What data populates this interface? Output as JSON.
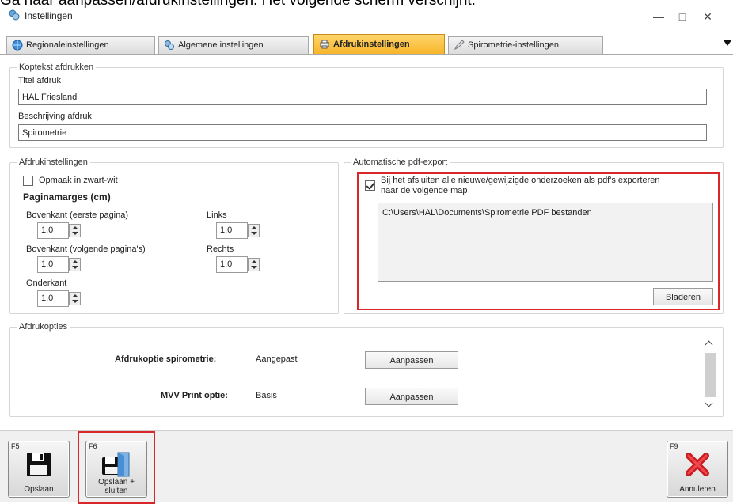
{
  "instruction": "Ga naar aanpassen/afdrukinstellingen. Het volgende scherm verschijnt:",
  "window": {
    "title": "Instellingen",
    "minimize": "—",
    "maximize": "□",
    "close": "✕"
  },
  "tabs": [
    {
      "label": "Regionaleinstellingen",
      "icon": "globe-icon",
      "active": false
    },
    {
      "label": "Algemene instellingen",
      "icon": "settings-icon",
      "active": false
    },
    {
      "label": "Afdrukinstellingen",
      "icon": "printer-icon",
      "active": true
    },
    {
      "label": "Spirometrie-instellingen",
      "icon": "pen-icon",
      "active": false
    }
  ],
  "header_group": {
    "legend": "Koptekst afdrukken",
    "title_label": "Titel afdruk",
    "title_value": "HAL Friesland",
    "desc_label": "Beschrijving afdruk",
    "desc_value": "Spirometrie"
  },
  "print_settings": {
    "legend": "Afdrukinstellingen",
    "bw_label": "Opmaak in zwart-wit",
    "bw_checked": false,
    "margins_heading": "Paginamarges (cm)",
    "top_first_label": "Bovenkant (eerste pagina)",
    "top_first_value": "1,0",
    "top_next_label": "Bovenkant (volgende pagina's)",
    "top_next_value": "1,0",
    "bottom_label": "Onderkant",
    "bottom_value": "1,0",
    "left_label": "Links",
    "left_value": "1,0",
    "right_label": "Rechts",
    "right_value": "1,0"
  },
  "pdf_export": {
    "legend": "Automatische pdf-export",
    "checkbox_label_line1": "Bij het afsluiten alle nieuwe/gewijzigde onderzoeken als pdf's exporteren",
    "checkbox_label_line2": "naar de volgende map",
    "checked": true,
    "path": "C:\\Users\\HAL\\Documents\\Spirometrie PDF bestanden",
    "browse_label": "Bladeren"
  },
  "print_options": {
    "legend": "Afdrukopties",
    "rows": [
      {
        "label": "Afdrukoptie spirometrie:",
        "value": "Aangepast",
        "button": "Aanpassen"
      },
      {
        "label": "MVV Print optie:",
        "value": "Basis",
        "button": "Aanpassen"
      }
    ]
  },
  "toolbar": {
    "save": {
      "key": "F5",
      "label": "Opslaan"
    },
    "save_close": {
      "key": "F6",
      "label_line1": "Opslaan +",
      "label_line2": "sluiten"
    },
    "cancel": {
      "key": "F9",
      "label": "Annuleren"
    }
  },
  "colors": {
    "highlight_red": "#d9262a",
    "active_tab": "#f7b52a"
  }
}
